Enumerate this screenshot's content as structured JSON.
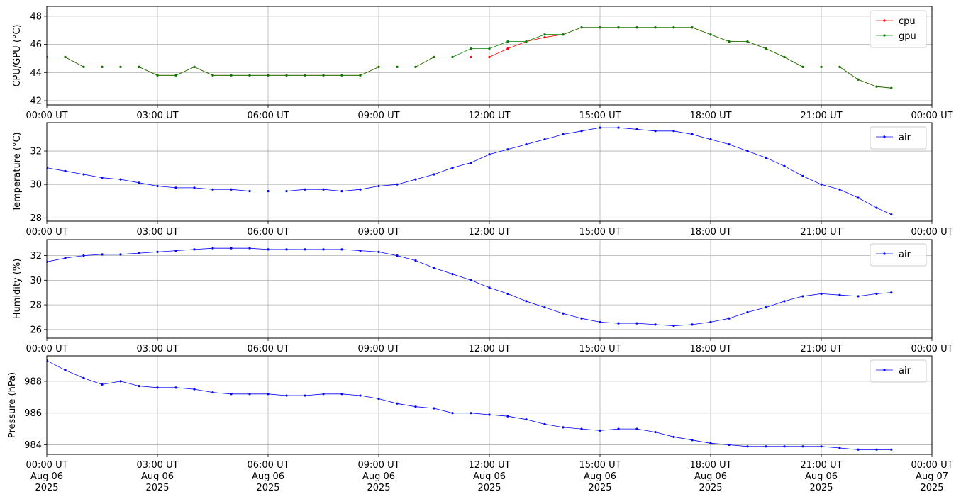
{
  "chart_data": [
    {
      "type": "line",
      "ylabel": "CPU/GPU (°C)",
      "ylim": [
        41.7,
        48.7
      ],
      "yticks": [
        42,
        44,
        46,
        48
      ],
      "x_ticks": [
        "00:00 UT",
        "03:00 UT",
        "06:00 UT",
        "09:00 UT",
        "12:00 UT",
        "15:00 UT",
        "18:00 UT",
        "21:00 UT",
        "00:00 UT"
      ],
      "x_range_hours": [
        0,
        24
      ],
      "grid": true,
      "legend": "top-right",
      "series": [
        {
          "name": "cpu",
          "color": "#ff0000",
          "x_hours": [
            0.0,
            0.5,
            1.0,
            1.5,
            2.0,
            2.5,
            3.0,
            3.5,
            4.0,
            4.5,
            5.0,
            5.5,
            6.0,
            6.5,
            7.0,
            7.5,
            8.0,
            8.5,
            9.0,
            9.5,
            10.0,
            10.5,
            11.0,
            11.5,
            12.0,
            12.5,
            13.0,
            13.5,
            14.0,
            14.5,
            15.0,
            15.5,
            16.0,
            16.5,
            17.0,
            17.5,
            18.0,
            18.5,
            19.0,
            19.5,
            20.0,
            20.5,
            21.0,
            21.5,
            22.0,
            22.5,
            22.9
          ],
          "values": [
            45.1,
            45.1,
            44.4,
            44.4,
            44.4,
            44.4,
            43.8,
            43.8,
            44.4,
            43.8,
            43.8,
            43.8,
            43.8,
            43.8,
            43.8,
            43.8,
            43.8,
            43.8,
            44.4,
            44.4,
            44.4,
            45.1,
            45.1,
            45.1,
            45.1,
            45.7,
            46.2,
            46.5,
            46.7,
            47.2,
            47.2,
            47.2,
            47.2,
            47.2,
            47.2,
            47.2,
            46.7,
            46.2,
            46.2,
            45.7,
            45.1,
            44.4,
            44.4,
            44.4,
            43.5,
            43.0,
            42.9
          ]
        },
        {
          "name": "gpu",
          "color": "#008000",
          "x_hours": [
            0.0,
            0.5,
            1.0,
            1.5,
            2.0,
            2.5,
            3.0,
            3.5,
            4.0,
            4.5,
            5.0,
            5.5,
            6.0,
            6.5,
            7.0,
            7.5,
            8.0,
            8.5,
            9.0,
            9.5,
            10.0,
            10.5,
            11.0,
            11.5,
            12.0,
            12.5,
            13.0,
            13.5,
            14.0,
            14.5,
            15.0,
            15.5,
            16.0,
            16.5,
            17.0,
            17.5,
            18.0,
            18.5,
            19.0,
            19.5,
            20.0,
            20.5,
            21.0,
            21.5,
            22.0,
            22.5,
            22.9
          ],
          "values": [
            45.1,
            45.1,
            44.4,
            44.4,
            44.4,
            44.4,
            43.8,
            43.8,
            44.4,
            43.8,
            43.8,
            43.8,
            43.8,
            43.8,
            43.8,
            43.8,
            43.8,
            43.8,
            44.4,
            44.4,
            44.4,
            45.1,
            45.1,
            45.7,
            45.7,
            46.2,
            46.2,
            46.7,
            46.7,
            47.2,
            47.2,
            47.2,
            47.2,
            47.2,
            47.2,
            47.2,
            46.7,
            46.2,
            46.2,
            45.7,
            45.1,
            44.4,
            44.4,
            44.4,
            43.5,
            43.0,
            42.9
          ]
        }
      ]
    },
    {
      "type": "line",
      "ylabel": "Temperature (°C)",
      "ylim": [
        27.8,
        33.7
      ],
      "yticks": [
        28,
        30,
        32
      ],
      "x_ticks": [
        "00:00 UT",
        "03:00 UT",
        "06:00 UT",
        "09:00 UT",
        "12:00 UT",
        "15:00 UT",
        "18:00 UT",
        "21:00 UT",
        "00:00 UT"
      ],
      "x_range_hours": [
        0,
        24
      ],
      "grid": true,
      "legend": "top-right",
      "series": [
        {
          "name": "air",
          "color": "#0000ff",
          "x_hours": [
            0.0,
            0.5,
            1.0,
            1.5,
            2.0,
            2.5,
            3.0,
            3.5,
            4.0,
            4.5,
            5.0,
            5.5,
            6.0,
            6.5,
            7.0,
            7.5,
            8.0,
            8.5,
            9.0,
            9.5,
            10.0,
            10.5,
            11.0,
            11.5,
            12.0,
            12.5,
            13.0,
            13.5,
            14.0,
            14.5,
            15.0,
            15.5,
            16.0,
            16.5,
            17.0,
            17.5,
            18.0,
            18.5,
            19.0,
            19.5,
            20.0,
            20.5,
            21.0,
            21.5,
            22.0,
            22.5,
            22.9
          ],
          "values": [
            31.0,
            30.8,
            30.6,
            30.4,
            30.3,
            30.1,
            29.9,
            29.8,
            29.8,
            29.7,
            29.7,
            29.6,
            29.6,
            29.6,
            29.7,
            29.7,
            29.6,
            29.7,
            29.9,
            30.0,
            30.3,
            30.6,
            31.0,
            31.3,
            31.8,
            32.1,
            32.4,
            32.7,
            33.0,
            33.2,
            33.4,
            33.4,
            33.3,
            33.2,
            33.2,
            33.0,
            32.7,
            32.4,
            32.0,
            31.6,
            31.1,
            30.5,
            30.0,
            29.7,
            29.2,
            28.6,
            28.2
          ]
        }
      ]
    },
    {
      "type": "line",
      "ylabel": "Humidity (%)",
      "ylim": [
        25.3,
        33.3
      ],
      "yticks": [
        26,
        28,
        30,
        32
      ],
      "x_ticks": [
        "00:00 UT",
        "03:00 UT",
        "06:00 UT",
        "09:00 UT",
        "12:00 UT",
        "15:00 UT",
        "18:00 UT",
        "21:00 UT",
        "00:00 UT"
      ],
      "x_range_hours": [
        0,
        24
      ],
      "grid": true,
      "legend": "top-right",
      "series": [
        {
          "name": "air",
          "color": "#0000ff",
          "x_hours": [
            0.0,
            0.5,
            1.0,
            1.5,
            2.0,
            2.5,
            3.0,
            3.5,
            4.0,
            4.5,
            5.0,
            5.5,
            6.0,
            6.5,
            7.0,
            7.5,
            8.0,
            8.5,
            9.0,
            9.5,
            10.0,
            10.5,
            11.0,
            11.5,
            12.0,
            12.5,
            13.0,
            13.5,
            14.0,
            14.5,
            15.0,
            15.5,
            16.0,
            16.5,
            17.0,
            17.5,
            18.0,
            18.5,
            19.0,
            19.5,
            20.0,
            20.5,
            21.0,
            21.5,
            22.0,
            22.5,
            22.9
          ],
          "values": [
            31.5,
            31.8,
            32.0,
            32.1,
            32.1,
            32.2,
            32.3,
            32.4,
            32.5,
            32.6,
            32.6,
            32.6,
            32.5,
            32.5,
            32.5,
            32.5,
            32.5,
            32.4,
            32.3,
            32.0,
            31.6,
            31.0,
            30.5,
            30.0,
            29.4,
            28.9,
            28.3,
            27.8,
            27.3,
            26.9,
            26.6,
            26.5,
            26.5,
            26.4,
            26.3,
            26.4,
            26.6,
            26.9,
            27.4,
            27.8,
            28.3,
            28.7,
            28.9,
            28.8,
            28.7,
            28.9,
            29.0
          ]
        }
      ]
    },
    {
      "type": "line",
      "ylabel": "Pressure (hPa)",
      "ylim": [
        983.4,
        989.6
      ],
      "yticks": [
        984,
        986,
        988
      ],
      "x_ticks": [
        "00:00 UT\nAug 06\n2025",
        "03:00 UT\nAug 06\n2025",
        "06:00 UT\nAug 06\n2025",
        "09:00 UT\nAug 06\n2025",
        "12:00 UT\nAug 06\n2025",
        "15:00 UT\nAug 06\n2025",
        "18:00 UT\nAug 06\n2025",
        "21:00 UT\nAug 06\n2025",
        "00:00 UT\nAug 07\n2025"
      ],
      "x_range_hours": [
        0,
        24
      ],
      "grid": true,
      "legend": "top-right",
      "series": [
        {
          "name": "air",
          "color": "#0000ff",
          "x_hours": [
            0.0,
            0.5,
            1.0,
            1.5,
            2.0,
            2.5,
            3.0,
            3.5,
            4.0,
            4.5,
            5.0,
            5.5,
            6.0,
            6.5,
            7.0,
            7.5,
            8.0,
            8.5,
            9.0,
            9.5,
            10.0,
            10.5,
            11.0,
            11.5,
            12.0,
            12.5,
            13.0,
            13.5,
            14.0,
            14.5,
            15.0,
            15.5,
            16.0,
            16.5,
            17.0,
            17.5,
            18.0,
            18.5,
            19.0,
            19.5,
            20.0,
            20.5,
            21.0,
            21.5,
            22.0,
            22.5,
            22.9
          ],
          "values": [
            989.3,
            988.7,
            988.2,
            987.8,
            988.0,
            987.7,
            987.6,
            987.6,
            987.5,
            987.3,
            987.2,
            987.2,
            987.2,
            987.1,
            987.1,
            987.2,
            987.2,
            987.1,
            986.9,
            986.6,
            986.4,
            986.3,
            986.0,
            986.0,
            985.9,
            985.8,
            985.6,
            985.3,
            985.1,
            985.0,
            984.9,
            985.0,
            985.0,
            984.8,
            984.5,
            984.3,
            984.1,
            984.0,
            983.9,
            983.9,
            983.9,
            983.9,
            983.9,
            983.8,
            983.7,
            983.7,
            983.7
          ]
        }
      ]
    }
  ]
}
